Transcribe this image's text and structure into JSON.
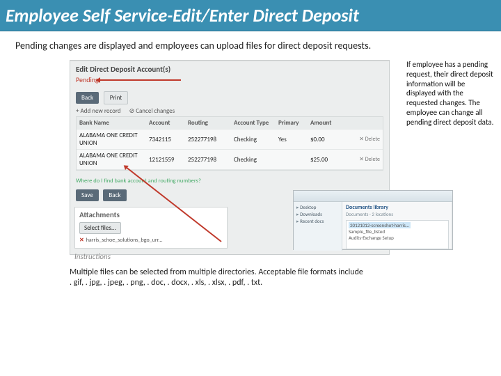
{
  "title": "Employee Self Service-Edit/Enter Direct Deposit",
  "intro": "Pending changes are displayed and employees can upload files for direct deposit requests.",
  "shot": {
    "header": "Edit Direct Deposit Account(s)",
    "pending": "Pending",
    "toolbar": {
      "back": "Back",
      "print": "Print"
    },
    "subbar": {
      "add": "+ Add new record",
      "cancel": "⊘ Cancel changes"
    },
    "cols": {
      "bank": "Bank Name",
      "acct": "Account",
      "routing": "Routing",
      "type": "Account Type",
      "primary": "Primary",
      "amount": "Amount"
    },
    "rows": [
      {
        "bank": "ALABAMA ONE CREDIT UNION",
        "acct": "7342115",
        "routing": "252277198",
        "type": "Checking",
        "primary": "Yes",
        "amount": "$0.00",
        "del": "✕ Delete"
      },
      {
        "bank": "ALABAMA ONE CREDIT UNION",
        "acct": "12121559",
        "routing": "252277198",
        "type": "Checking",
        "primary": "",
        "amount": "$25.00",
        "del": "✕ Delete"
      }
    ],
    "where": "Where do I find bank account and routing numbers?",
    "save": "Save",
    "backbtn": "Back",
    "attach": {
      "hd": "Attachments",
      "select": "Select files...",
      "file": "harris_schoe_solutions_bgo_urr...",
      "x": "✕"
    },
    "instructions": "Instructions",
    "dialog": {
      "side": [
        "Desktop",
        "Downloads",
        "Recent docs"
      ],
      "lib": "Documents library",
      "sub": "Documents · 2 locations",
      "files": [
        "20121012-screenshot-harris…",
        "Sample_file_listed",
        "Audits-Exchange Setup"
      ]
    }
  },
  "sidenote": "If employee has a pending request, their direct deposit information will be displayed with the requested changes. The employee can change all pending direct deposit data.",
  "bottom": {
    "l1": "Multiple files can be selected from multiple directories.  Acceptable file formats include",
    "l2": ". gif, . jpg, . jpeg, . png, . doc, . docx, . xls, . xlsx, . pdf, . txt."
  }
}
